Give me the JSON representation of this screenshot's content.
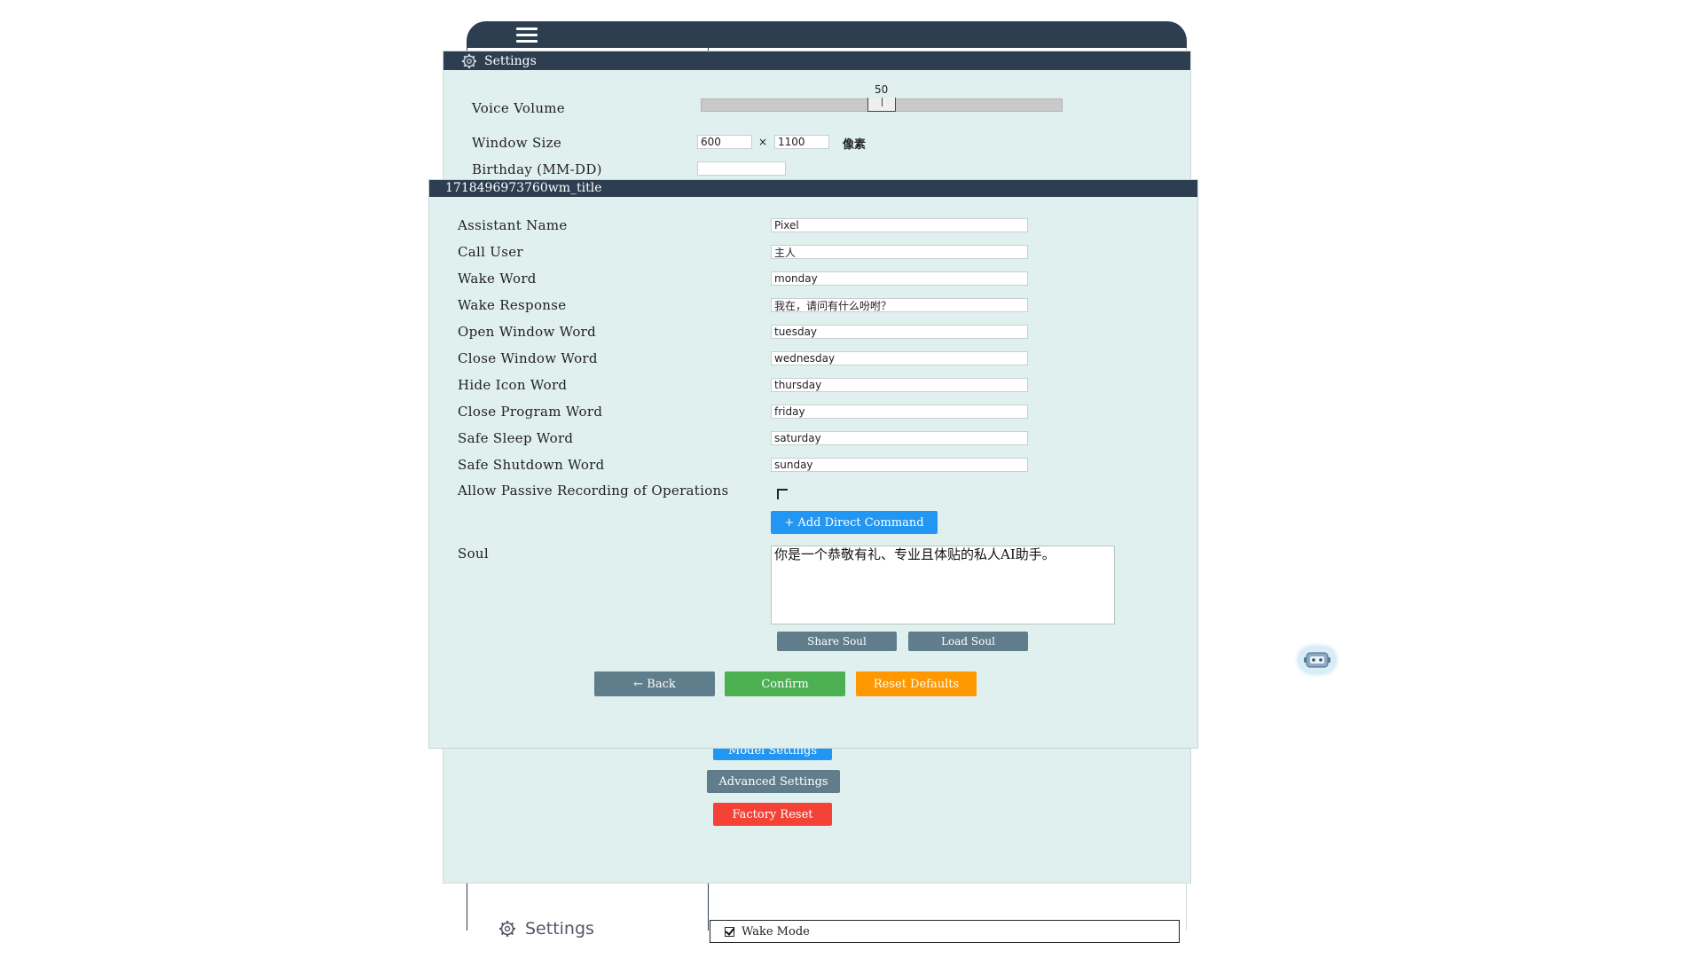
{
  "app": {
    "sidebar_label": "Settings",
    "wake_mode_label": "Wake Mode"
  },
  "settings": {
    "title": "Settings",
    "voice_volume_label": "Voice Volume",
    "voice_volume_value": "50",
    "voice_volume_level": 50,
    "window_size_label": "Window Size",
    "window_width": "600",
    "window_height": "1100",
    "times_sign": "×",
    "pixel_unit": "像素",
    "birthday_label": "Birthday (MM-DD)",
    "birthday_value": "",
    "buttons": {
      "model_settings": "Model Settings",
      "advanced_settings": "Advanced Settings",
      "factory_reset": "Factory Reset"
    }
  },
  "wake": {
    "title": "1718496973760wm_title",
    "fields": [
      {
        "label": "Assistant Name",
        "value": "Pixel"
      },
      {
        "label": "Call User",
        "value": "主人"
      },
      {
        "label": "Wake Word",
        "value": "monday"
      },
      {
        "label": "Wake Response",
        "value": "我在，请问有什么吩咐？"
      },
      {
        "label": "Open Window Word",
        "value": "tuesday"
      },
      {
        "label": "Close Window Word",
        "value": "wednesday"
      },
      {
        "label": "Hide Icon Word",
        "value": "thursday"
      },
      {
        "label": "Close Program Word",
        "value": "friday"
      },
      {
        "label": "Safe Sleep Word",
        "value": "saturday"
      },
      {
        "label": "Safe Shutdown Word",
        "value": "sunday"
      }
    ],
    "passive_recording_label": "Allow Passive Recording of Operations",
    "add_direct_command": "+ Add Direct Command",
    "soul_label": "Soul",
    "soul_text": "你是一个恭敬有礼、专业且体贴的私人AI助手。",
    "share_soul": "Share Soul",
    "load_soul": "Load Soul",
    "back": "← Back",
    "confirm": "Confirm",
    "reset_defaults": "Reset Defaults"
  },
  "colors": {
    "titlebar": "#2c3e50",
    "dialog_bg": "#e0f0ef",
    "blue": "#2196f3",
    "gray": "#607d8b",
    "green": "#4caf50",
    "orange": "#ff9800",
    "red": "#f44336"
  }
}
